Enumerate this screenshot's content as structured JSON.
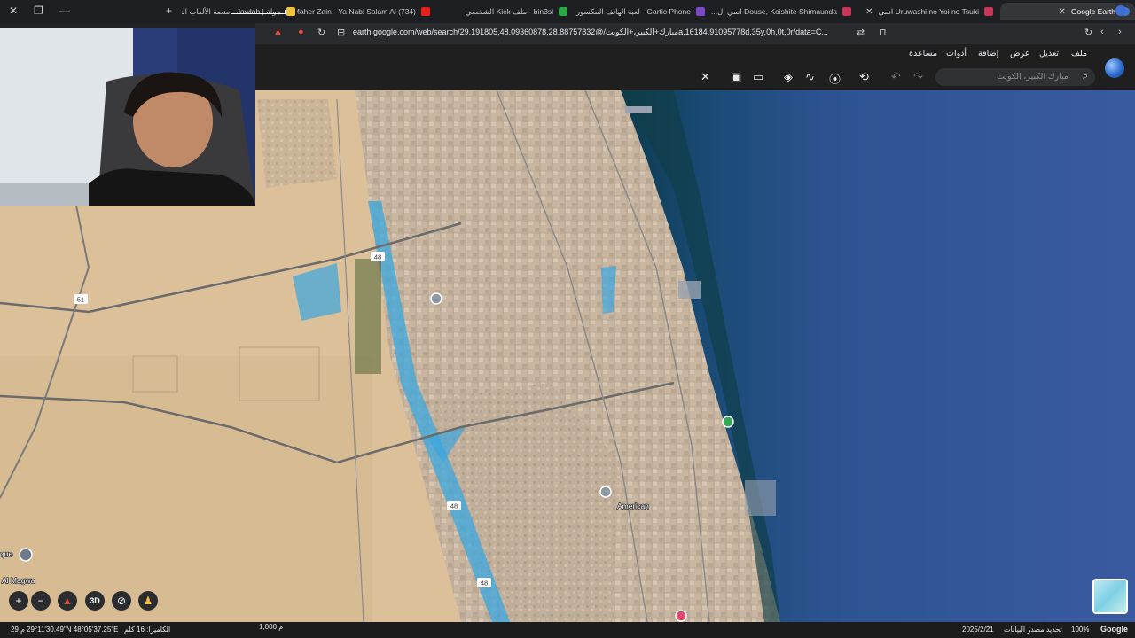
{
  "tabs": [
    {
      "title": "Google Earth",
      "active": true
    },
    {
      "title": "Uruwashi no Yoi no Tsuki انمي",
      "active": false
    },
    {
      "title": "Douse, Koishite Shimaunda انمي ال...",
      "active": false
    },
    {
      "title": "Gartic Phone - لعبة الهاتف المكسور",
      "active": false
    },
    {
      "title": "bin3sl - ملف Kick الشخصي",
      "active": false
    },
    {
      "title": "(734) Maher Zain - Ya Nabi Salam Al...",
      "active": false
    },
    {
      "title": "جولة | Jawlah - منصة الألعاب التفاعلية",
      "active": false
    }
  ],
  "address": {
    "url": "earth.google.com/web/search/مبارك+الكبير،+الكويت/@29.191805,48.09360878,28.88757832a,16184.91095778d,35y,0h,0t,0r/data=C..."
  },
  "menu": [
    "ملف",
    "تعديل",
    "عرض",
    "إضافة",
    "أدوات",
    "مساعدة"
  ],
  "search": {
    "placeholder": "مبارك الكبير، الكويت"
  },
  "toolbar_icons": [
    "undo-icon",
    "redo-icon",
    "history-icon",
    "pin-icon",
    "path-icon",
    "layers-icon",
    "ruler-icon",
    "photo-icon",
    "measure-icon"
  ],
  "map_labels": {
    "road_48_a": "48",
    "road_48_b": "48",
    "road_48_c": "48",
    "road_51": "51",
    "american": "American",
    "mosque": "que",
    "magwa": "Al Magwa",
    "b3d": "3D"
  },
  "status": {
    "coords": "29°11'30.49\"N 48°05'37.25\"E",
    "elevation": "29 م",
    "camera": "الكاميرا: 16 كلم",
    "scale": "1,000 م",
    "date": "2025/2/21",
    "source": "تحديد مصدر البيانات",
    "zoom": "100%",
    "brand": "Google"
  },
  "colors": {
    "sea": "#1f4f8a",
    "land": "#d9bf95",
    "urban": "#c9b8a3",
    "water_highlight": "#3ba7e0"
  }
}
